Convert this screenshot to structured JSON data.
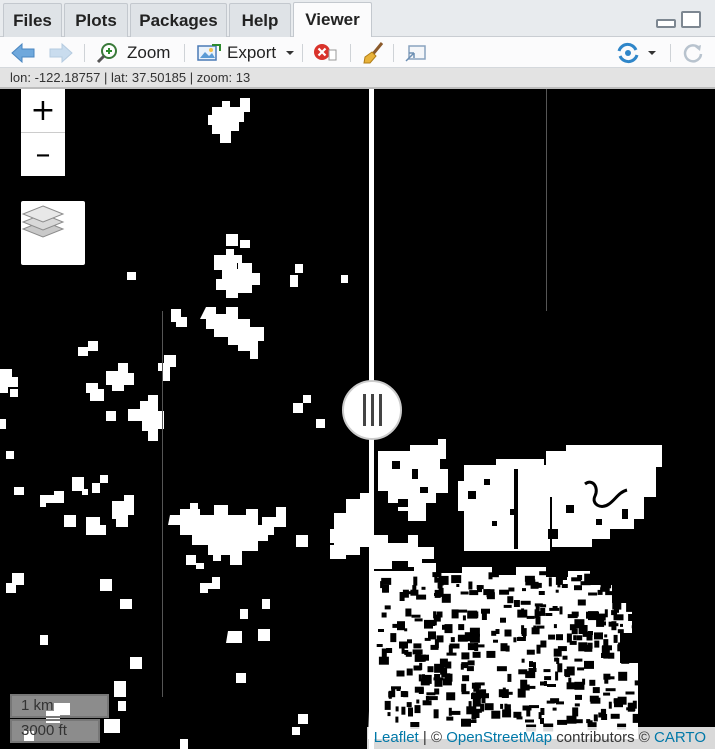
{
  "tabs": [
    {
      "label": "Files",
      "active": false
    },
    {
      "label": "Plots",
      "active": false
    },
    {
      "label": "Packages",
      "active": false
    },
    {
      "label": "Help",
      "active": false
    },
    {
      "label": "Viewer",
      "active": true
    }
  ],
  "toolbar": {
    "zoom_label": "Zoom",
    "export_label": "Export"
  },
  "readout": "lon: -122.18757 | lat: 37.50185 | zoom: 13",
  "map": {
    "zoom_in": "+",
    "zoom_out": "–",
    "scale_metric": "1 km",
    "scale_imperial": "3000 ft",
    "attribution": {
      "leaflet": "Leaflet",
      "sep1": " | © ",
      "osm": "OpenStreetMap",
      "mid": " contributors © ",
      "carto": "CARTO"
    }
  },
  "colors": {
    "accent_blue": "#0078a8",
    "map_background": "#000000",
    "map_features": "#ffffff"
  }
}
